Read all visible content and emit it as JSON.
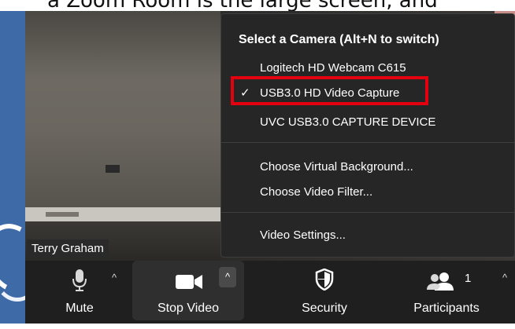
{
  "top_text": "a Zoom Room is the large screen, and",
  "video": {
    "participant_name": "Terry Graham"
  },
  "camera_menu": {
    "heading": "Select a Camera (Alt+N to switch)",
    "cameras": [
      {
        "label": "Logitech HD Webcam C615",
        "selected": false
      },
      {
        "label": "USB3.0 HD Video Capture",
        "selected": true
      },
      {
        "label": "UVC USB3.0 CAPTURE DEVICE",
        "selected": false
      }
    ],
    "options": [
      {
        "label": "Choose Virtual Background..."
      },
      {
        "label": "Choose Video Filter..."
      }
    ],
    "settings": {
      "label": "Video Settings..."
    },
    "check_glyph": "✓",
    "highlight_color": "#e3000f"
  },
  "toolbar": {
    "mute_label": "Mute",
    "stop_video_label": "Stop Video",
    "security_label": "Security",
    "participants_label": "Participants",
    "participants_count": "1",
    "caret_glyph": "^"
  },
  "icons": [
    "microphone-icon",
    "video-camera-icon",
    "shield-icon",
    "participants-icon",
    "chevron-up-icon",
    "checkmark-icon"
  ]
}
